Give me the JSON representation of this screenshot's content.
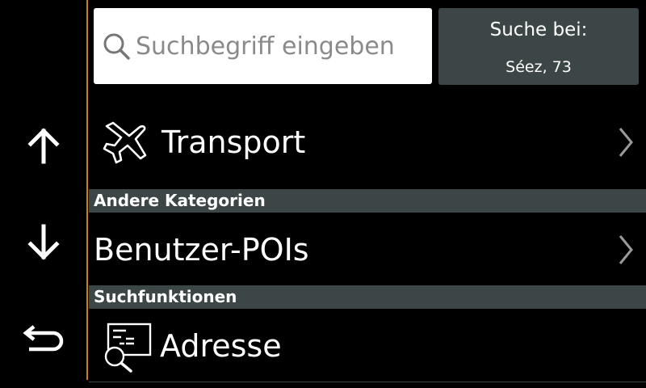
{
  "search": {
    "placeholder": "Suchbegriff eingeben"
  },
  "near": {
    "label": "Suche bei:",
    "location": "Séez, 73"
  },
  "categories": [
    {
      "label": "Transport",
      "icon": "airplane-icon"
    }
  ],
  "sections": [
    {
      "header": "Andere Kategorien",
      "items": [
        {
          "label": "Benutzer-POIs"
        }
      ]
    },
    {
      "header": "Suchfunktionen",
      "items": [
        {
          "label": "Adresse",
          "icon": "address-search-icon"
        }
      ]
    }
  ],
  "nav": {
    "up": "up-arrow-icon",
    "down": "down-arrow-icon",
    "back": "back-icon"
  },
  "colors": {
    "accent": "#c8811f",
    "header_bg": "#3d4646",
    "background": "#000000"
  }
}
